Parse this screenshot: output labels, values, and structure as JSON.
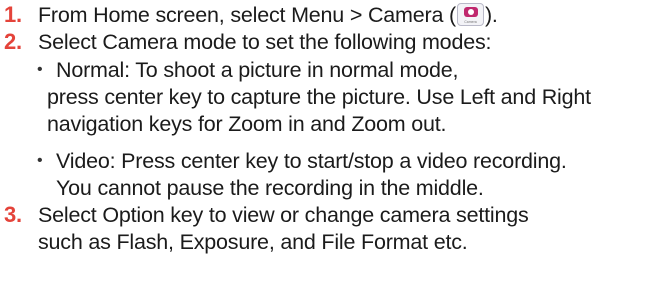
{
  "steps": [
    {
      "number": "1.",
      "text_before": "From Home screen, select Menu > Camera (",
      "icon": "camera-app-icon",
      "icon_caption": "Camera",
      "text_after": ")."
    },
    {
      "number": "2.",
      "text": "Select Camera mode to set the following modes:",
      "bullets": [
        {
          "lines": [
            "Normal: To shoot a picture in normal mode,",
            "press center key to capture the picture. Use Left and Right",
            "navigation keys for Zoom in and Zoom out."
          ]
        },
        {
          "lines": [
            "Video: Press center key to start/stop a video recording.",
            "You cannot pause the recording in the middle."
          ]
        }
      ]
    },
    {
      "number": "3.",
      "lines": [
        "Select Option key to view or change camera settings",
        "such as Flash, Exposure, and File Format etc."
      ]
    }
  ],
  "colors": {
    "step_number": "#e4433a",
    "text": "#1b1b1b",
    "icon_accent": "#c0286e"
  }
}
